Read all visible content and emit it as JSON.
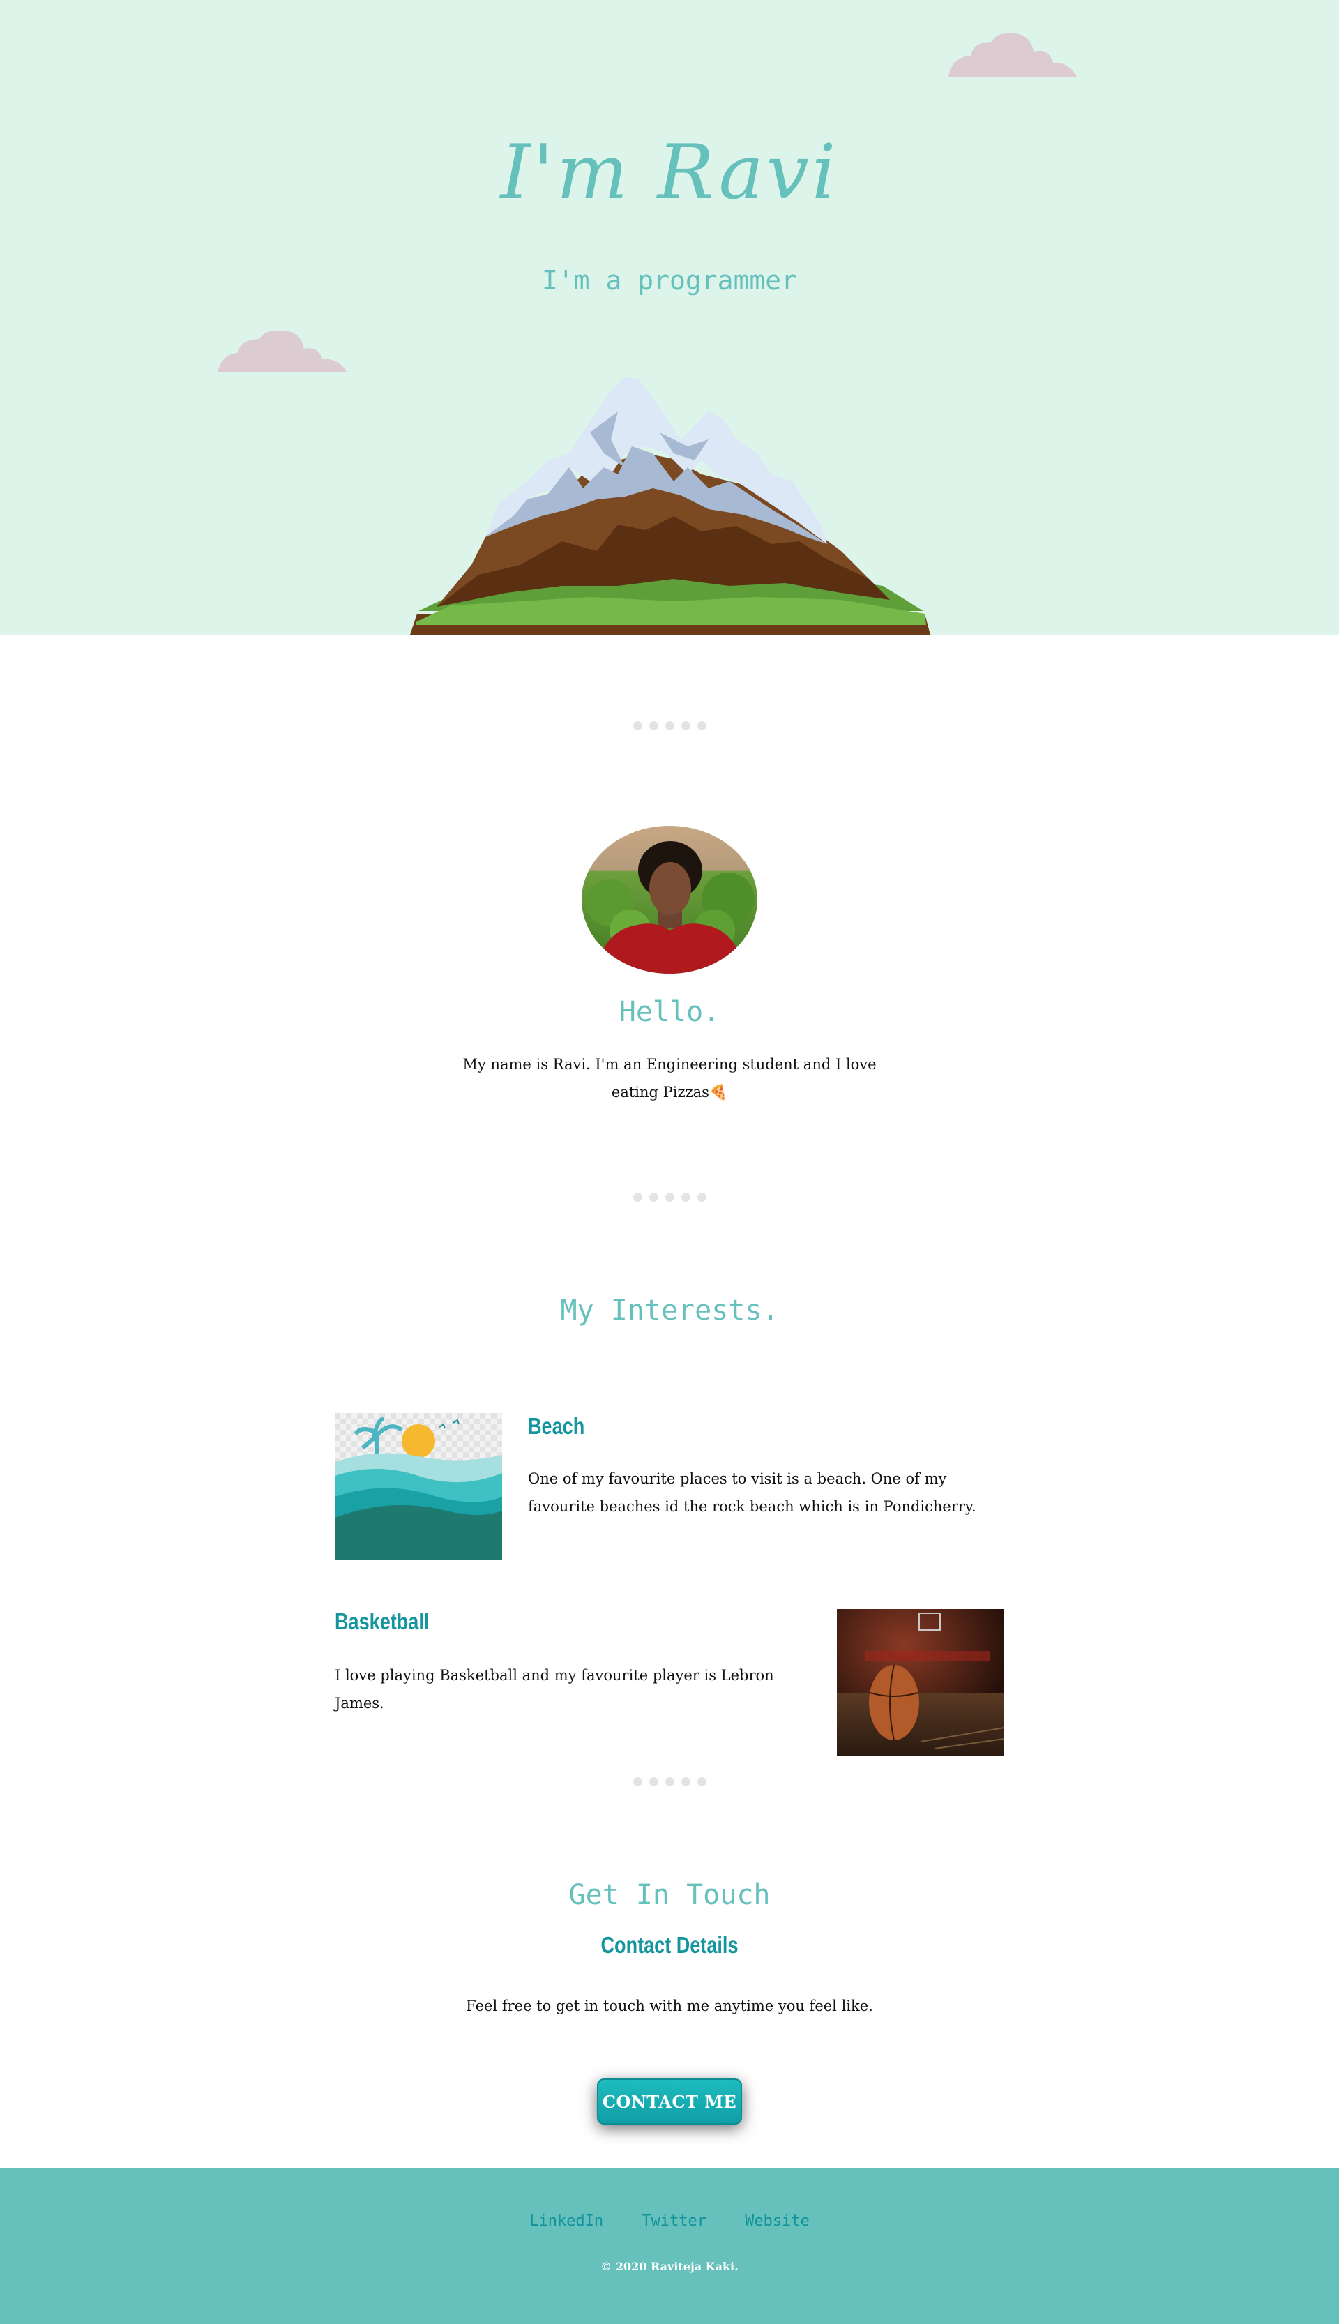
{
  "hero": {
    "title": "I'm Ravi",
    "subtitle": "I'm a programmer"
  },
  "about": {
    "greeting": "Hello.",
    "intro": "My name is Ravi. I'm an Engineering student and I love eating Pizzas",
    "intro_emoji": "🍕"
  },
  "interests": {
    "title": "My Interests.",
    "items": [
      {
        "title": "Beach",
        "text": "One of my favourite places to visit is a beach. One of my favourite beaches id the rock beach which is in Pondicherry."
      },
      {
        "title": "Basketball",
        "text": "I love playing Basketball and my favourite player is Lebron James."
      }
    ]
  },
  "contact": {
    "title": "Get In Touch",
    "subtitle": "Contact Details",
    "text": "Feel free to get in touch with me anytime you feel like.",
    "button_label": "CONTACT ME"
  },
  "footer": {
    "links": [
      "LinkedIn",
      "Twitter",
      "Website"
    ],
    "copyright": "© 2020 Raviteja Kaki."
  },
  "colors": {
    "hero_bg": "#dcf4e9",
    "accent": "#66c0bc",
    "heading_teal": "#15959e",
    "cloud": "#dccbd0",
    "footer_bg": "#66c0bc"
  }
}
